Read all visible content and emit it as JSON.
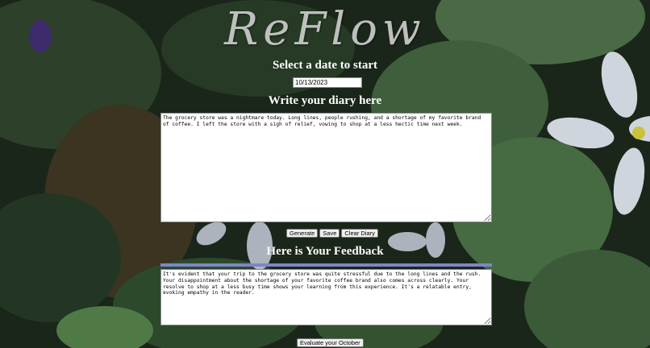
{
  "app": {
    "logo": "ReFlow"
  },
  "date_section": {
    "heading": "Select a date to start",
    "date_value": "10/13/2023"
  },
  "diary_section": {
    "heading": "Write your diary here",
    "text": "The grocery store was a nightmare today. Long lines, people rushing, and a shortage of my favorite brand of coffee. I left the store with a sigh of relief, vowing to shop at a less hectic time next week."
  },
  "actions": {
    "generate_label": "Generate",
    "save_label": "Save",
    "clear_label": "Clear Diary"
  },
  "feedback_section": {
    "heading": "Here is Your Feedback",
    "text": "It's evident that your trip to the grocery store was quite stressful due to the long lines and the rush. Your disappointment about the shortage of your favorite coffee brand also comes across clearly. Your resolve to shop at a less busy time shows your learning from this experience. It's a relatable entry, evoking empathy in the reader."
  },
  "evaluate": {
    "label": "Evaluate your October"
  },
  "colors": {
    "divider": "#7f85c9",
    "heading_text": "#ffffff"
  }
}
